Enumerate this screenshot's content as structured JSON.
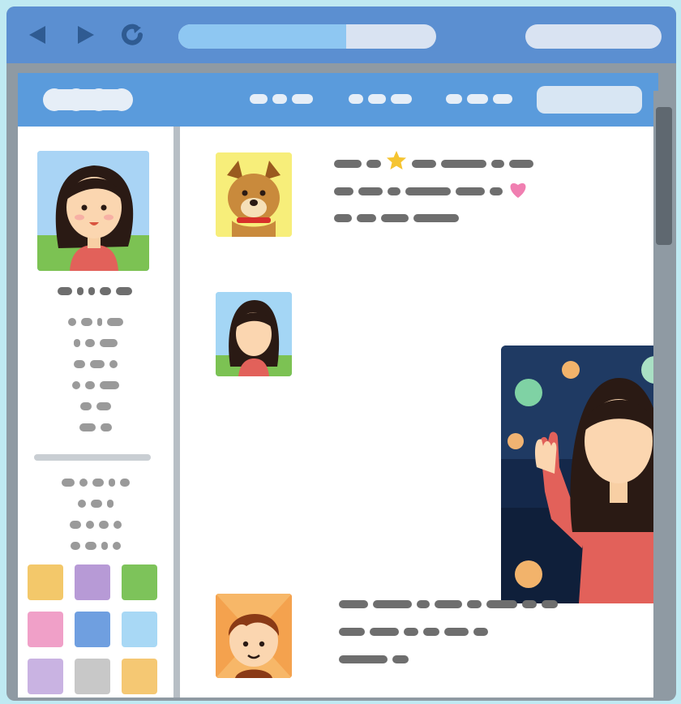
{
  "browser": {
    "nav_icons": [
      "back-icon",
      "forward-icon",
      "reload-icon"
    ],
    "url_progress_percent": 65
  },
  "colors": {
    "chrome": "#5b8fd1",
    "site_header": "#5a9bdc",
    "sidebar_border": "#b7bec5",
    "text_placeholder": "#6e6e6e",
    "swatches": [
      "#f3c86a",
      "#b79ad6",
      "#7dc35a",
      "#f0a0c8",
      "#6f9fe0",
      "#a8d8f5",
      "#c9b3e2",
      "#c8c8c8",
      "#f5c873"
    ],
    "bubble_colors": [
      "#f2b36b",
      "#a9e0c4",
      "#7fd2a4",
      "#f4a9ba",
      "#f1b372",
      "#e9ed6a",
      "#74d37c",
      "#f1b372"
    ]
  },
  "icons": {
    "post_1_star": "star-icon",
    "post_1_heart": "heart-icon"
  },
  "posts": [
    {
      "author_avatar": "dog-avatar"
    },
    {
      "author_avatar": "woman-avatar",
      "has_image": true
    },
    {
      "author_avatar": "boy-avatar"
    }
  ]
}
